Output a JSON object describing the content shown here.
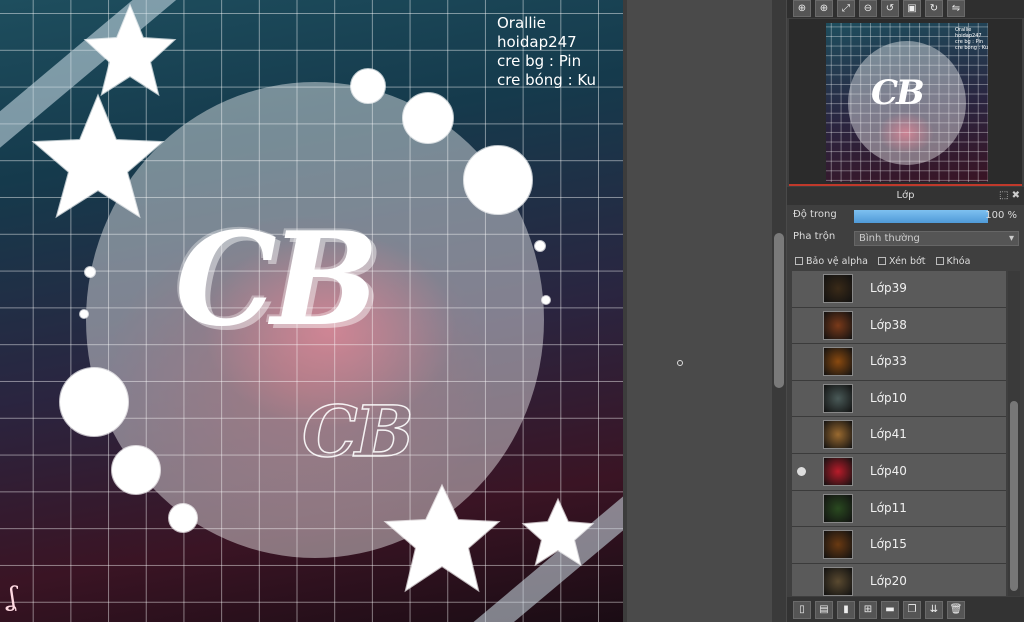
{
  "artwork": {
    "credits": [
      "Orallie",
      "hoidap247",
      "cre bg : Pin",
      "cre bóng : Ku"
    ],
    "logo_text": "CB",
    "logo_small_text": "CB",
    "signature": "ʆ"
  },
  "navigator": {
    "toolbar_icons": [
      "zoom-in-icon",
      "zoom-in-icon",
      "fit-screen-icon",
      "zoom-out-icon",
      "rotate-left-icon",
      "fullscreen-icon",
      "rotate-right-icon",
      "flip-icon"
    ]
  },
  "layer_panel": {
    "title": "Lớp",
    "opacity_label": "Độ trong",
    "opacity_value": "100 %",
    "opacity_fraction": 1.0,
    "blend_label": "Pha trộn",
    "blend_value": "Bình thường",
    "checkboxes": [
      {
        "label": "Bảo vệ alpha"
      },
      {
        "label": "Xén bớt"
      },
      {
        "label": "Khóa"
      }
    ],
    "layers": [
      {
        "name": "Lớp39",
        "visible": false,
        "color": "#3a2a18"
      },
      {
        "name": "Lớp38",
        "visible": false,
        "color": "#7a3a1a"
      },
      {
        "name": "Lớp33",
        "visible": false,
        "color": "#8a4a10"
      },
      {
        "name": "Lớp10",
        "visible": false,
        "color": "#4a5a58"
      },
      {
        "name": "Lớp41",
        "visible": false,
        "color": "#9a6a30"
      },
      {
        "name": "Lớp40",
        "visible": true,
        "color": "#b81c2a"
      },
      {
        "name": "Lớp11",
        "visible": false,
        "color": "#2a4a20"
      },
      {
        "name": "Lớp15",
        "visible": false,
        "color": "#6a3a12"
      },
      {
        "name": "Lớp20",
        "visible": false,
        "color": "#5a4a30"
      }
    ],
    "bottom_icons": [
      "new-layer-icon",
      "new-layer-special-icon",
      "new-raster-icon",
      "add-layer-menu-icon",
      "folder-icon",
      "duplicate-layer-icon",
      "merge-layer-icon",
      "delete-layer-icon"
    ]
  }
}
